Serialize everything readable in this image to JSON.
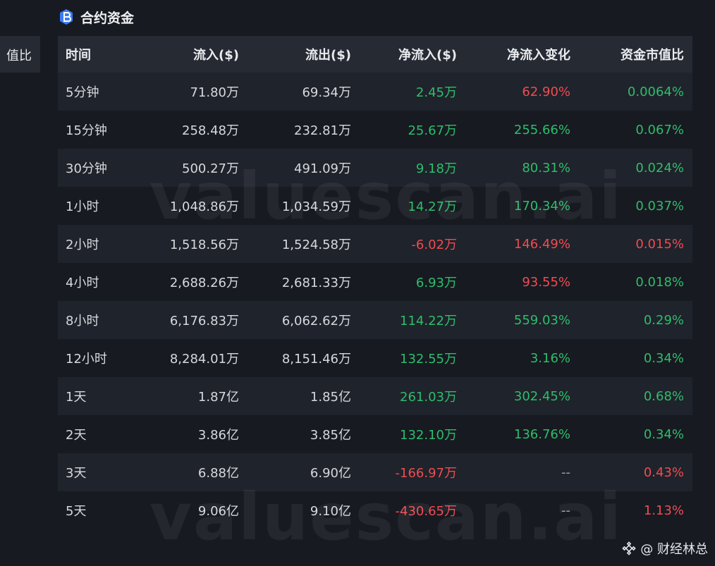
{
  "left_panel": {
    "label": "值比"
  },
  "header": {
    "title": "合约资金",
    "icon": "b-coin-icon"
  },
  "table": {
    "columns": [
      "时间",
      "流入($)",
      "流出($)",
      "净流入($)",
      "净流入变化",
      "资金市值比"
    ],
    "rows": [
      {
        "time": "5分钟",
        "inflow": "71.80万",
        "outflow": "69.34万",
        "net": "2.45万",
        "net_sign": "pos",
        "change": "62.90%",
        "change_sign": "neg",
        "ratio": "0.0064%",
        "ratio_sign": "pos"
      },
      {
        "time": "15分钟",
        "inflow": "258.48万",
        "outflow": "232.81万",
        "net": "25.67万",
        "net_sign": "pos",
        "change": "255.66%",
        "change_sign": "pos",
        "ratio": "0.067%",
        "ratio_sign": "pos"
      },
      {
        "time": "30分钟",
        "inflow": "500.27万",
        "outflow": "491.09万",
        "net": "9.18万",
        "net_sign": "pos",
        "change": "80.31%",
        "change_sign": "pos",
        "ratio": "0.024%",
        "ratio_sign": "pos"
      },
      {
        "time": "1小时",
        "inflow": "1,048.86万",
        "outflow": "1,034.59万",
        "net": "14.27万",
        "net_sign": "pos",
        "change": "170.34%",
        "change_sign": "pos",
        "ratio": "0.037%",
        "ratio_sign": "pos"
      },
      {
        "time": "2小时",
        "inflow": "1,518.56万",
        "outflow": "1,524.58万",
        "net": "-6.02万",
        "net_sign": "neg",
        "change": "146.49%",
        "change_sign": "neg",
        "ratio": "0.015%",
        "ratio_sign": "neg"
      },
      {
        "time": "4小时",
        "inflow": "2,688.26万",
        "outflow": "2,681.33万",
        "net": "6.93万",
        "net_sign": "pos",
        "change": "93.55%",
        "change_sign": "neg",
        "ratio": "0.018%",
        "ratio_sign": "pos"
      },
      {
        "time": "8小时",
        "inflow": "6,176.83万",
        "outflow": "6,062.62万",
        "net": "114.22万",
        "net_sign": "pos",
        "change": "559.03%",
        "change_sign": "pos",
        "ratio": "0.29%",
        "ratio_sign": "pos"
      },
      {
        "time": "12小时",
        "inflow": "8,284.01万",
        "outflow": "8,151.46万",
        "net": "132.55万",
        "net_sign": "pos",
        "change": "3.16%",
        "change_sign": "pos",
        "ratio": "0.34%",
        "ratio_sign": "pos"
      },
      {
        "time": "1天",
        "inflow": "1.87亿",
        "outflow": "1.85亿",
        "net": "261.03万",
        "net_sign": "pos",
        "change": "302.45%",
        "change_sign": "pos",
        "ratio": "0.68%",
        "ratio_sign": "pos"
      },
      {
        "time": "2天",
        "inflow": "3.86亿",
        "outflow": "3.85亿",
        "net": "132.10万",
        "net_sign": "pos",
        "change": "136.76%",
        "change_sign": "pos",
        "ratio": "0.34%",
        "ratio_sign": "pos"
      },
      {
        "time": "3天",
        "inflow": "6.88亿",
        "outflow": "6.90亿",
        "net": "-166.97万",
        "net_sign": "neg",
        "change": "--",
        "change_sign": "muted",
        "ratio": "0.43%",
        "ratio_sign": "neg"
      },
      {
        "time": "5天",
        "inflow": "9.06亿",
        "outflow": "9.10亿",
        "net": "-430.65万",
        "net_sign": "neg",
        "change": "--",
        "change_sign": "muted",
        "ratio": "1.13%",
        "ratio_sign": "neg"
      }
    ]
  },
  "watermark": "valuescan.ai",
  "footer": {
    "text": "@ 财经林总",
    "icon": "binance-logo-icon"
  },
  "colors": {
    "positive": "#2ebd6b",
    "negative": "#f04b52",
    "background": "#171a21",
    "header_bg": "#262a33",
    "brand_icon": "#3b7cf5"
  }
}
